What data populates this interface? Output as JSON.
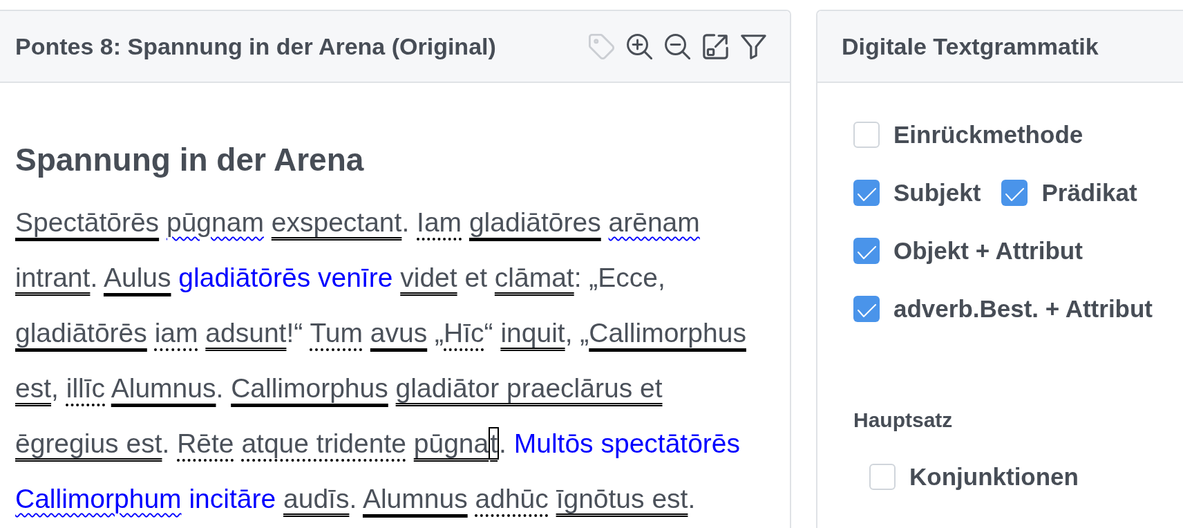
{
  "text_panel": {
    "title": "Pontes 8: Spannung in der Arena (Original)",
    "toolbar": [
      {
        "kind": "tag",
        "disabled": true
      },
      {
        "kind": "zoomin",
        "disabled": false
      },
      {
        "kind": "zoomout",
        "disabled": false
      },
      {
        "kind": "popout",
        "disabled": false
      },
      {
        "kind": "filter",
        "disabled": false
      }
    ],
    "heading": "Spannung in der Arena",
    "lines": [
      [
        {
          "text": "Spectātōrēs ",
          "kind": "solid"
        },
        {
          "text": "pūgnam ",
          "kind": "wavy"
        },
        {
          "text": "exspectant",
          "kind": "double"
        },
        {
          "text": ". ",
          "kind": "plain"
        },
        {
          "text": "Iam ",
          "kind": "dotted"
        },
        {
          "text": "gladiātōres ",
          "kind": "solid"
        },
        {
          "text": "arēnam",
          "kind": "wavy"
        }
      ],
      [
        {
          "text": "intrant",
          "kind": "double"
        },
        {
          "text": ". ",
          "kind": "plain"
        },
        {
          "text": "Aulus ",
          "kind": "solid"
        },
        {
          "text": "gladiātōrēs venīre ",
          "kind": "blue"
        },
        {
          "text": "videt",
          "kind": "double"
        },
        {
          "text": " et ",
          "kind": "plain"
        },
        {
          "text": "clāmat",
          "kind": "double"
        },
        {
          "text": ": „Ecce,",
          "kind": "plain"
        }
      ],
      [
        {
          "text": "gladiātōrēs ",
          "kind": "solid"
        },
        {
          "text": "iam ",
          "kind": "dotted"
        },
        {
          "text": "adsunt",
          "kind": "double"
        },
        {
          "text": "!“ ",
          "kind": "plain"
        },
        {
          "text": "Tum ",
          "kind": "dotted"
        },
        {
          "text": "avus",
          "kind": "solid"
        },
        {
          "text": " „",
          "kind": "plain"
        },
        {
          "text": "Hīc",
          "kind": "dotted"
        },
        {
          "text": "“ ",
          "kind": "plain"
        },
        {
          "text": "inquit",
          "kind": "double"
        },
        {
          "text": ", „",
          "kind": "plain"
        },
        {
          "text": "Callimorphus",
          "kind": "solid"
        }
      ],
      [
        {
          "text": "est",
          "kind": "double"
        },
        {
          "text": ", ",
          "kind": "plain"
        },
        {
          "text": "illīc ",
          "kind": "dotted"
        },
        {
          "text": "Alumnus",
          "kind": "solid"
        },
        {
          "text": ". ",
          "kind": "plain"
        },
        {
          "text": "Callimorphus ",
          "kind": "solid"
        },
        {
          "text": "gladiātor praeclārus et",
          "kind": "double"
        }
      ],
      [
        {
          "text": "ēgregius est",
          "kind": "double"
        },
        {
          "text": ". ",
          "kind": "plain"
        },
        {
          "text": "Rēte ",
          "kind": "dotted"
        },
        {
          "text": "atque tridente ",
          "kind": "dotted"
        },
        {
          "text": "pūgna",
          "kind": "double"
        },
        {
          "text": "t",
          "kind": "boxed"
        },
        {
          "text": ". ",
          "kind": "plain"
        },
        {
          "text": "Multōs spectātōrēs",
          "kind": "blue"
        }
      ],
      [
        {
          "text": "Callimorphum ",
          "kind": "bluewavy"
        },
        {
          "text": "incitāre ",
          "kind": "blue"
        },
        {
          "text": "audīs",
          "kind": "double"
        },
        {
          "text": ". ",
          "kind": "plain"
        },
        {
          "text": "Alumnus ",
          "kind": "solid"
        },
        {
          "text": "adhūc ",
          "kind": "dotted"
        },
        {
          "text": "īgnōtus est",
          "kind": "double"
        },
        {
          "text": ".",
          "kind": "plain"
        }
      ]
    ]
  },
  "grammar_panel": {
    "title": "Digitale Textgrammatik",
    "option_rows": [
      [
        {
          "label": "Einrückmethode",
          "checked": false
        }
      ],
      [
        {
          "label": "Subjekt",
          "checked": true
        },
        {
          "label": "Prädikat",
          "checked": true
        }
      ],
      [
        {
          "label": "Objekt + Attribut",
          "checked": true
        }
      ],
      [
        {
          "label": "adverb.Best. + Attribut",
          "checked": true
        }
      ]
    ],
    "sections": [
      {
        "title": "Hauptsatz",
        "options": [
          {
            "label": "Konjunktionen",
            "checked": false
          }
        ]
      }
    ]
  }
}
